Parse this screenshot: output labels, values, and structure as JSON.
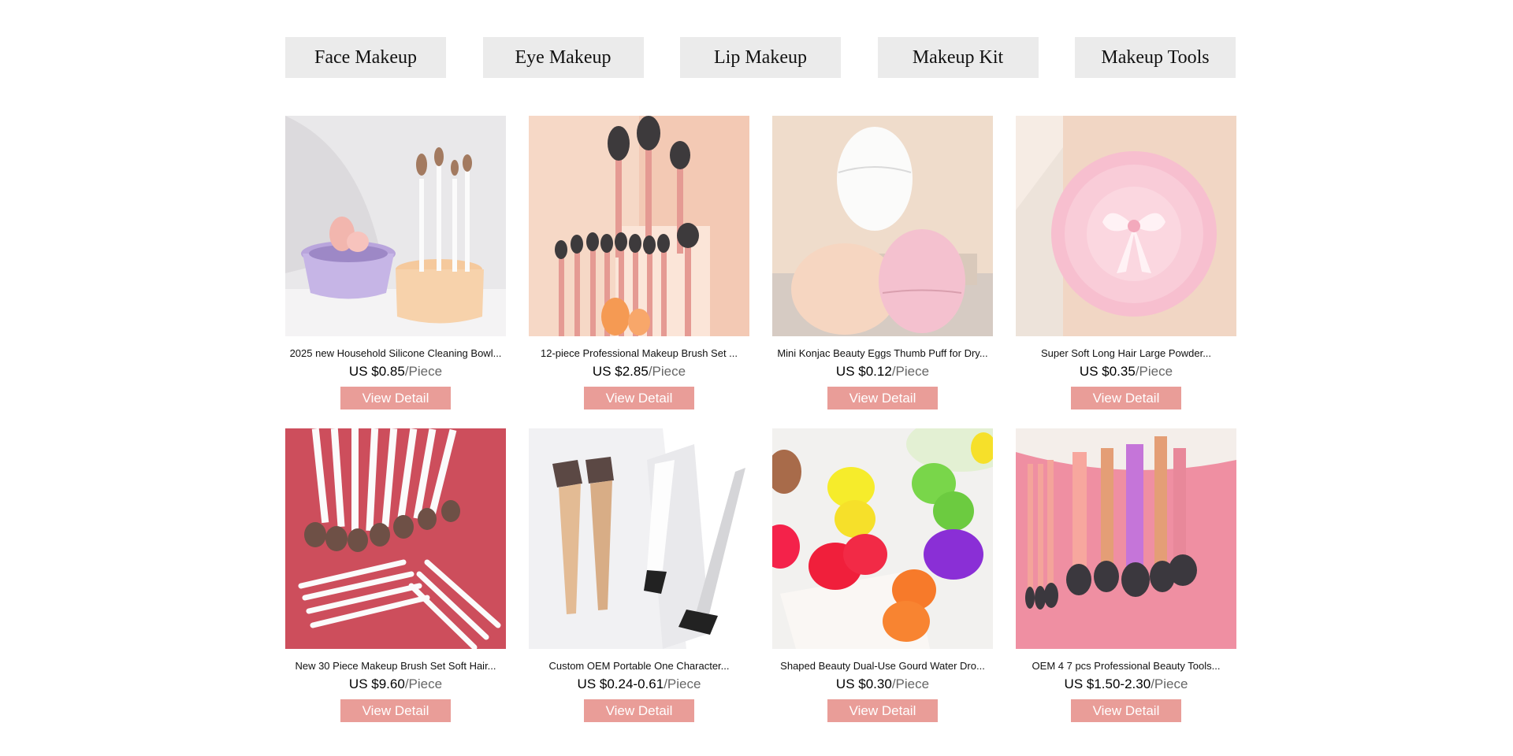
{
  "categories": [
    "Face Makeup",
    "Eye Makeup",
    "Lip Makeup",
    "Makeup Kit",
    "Makeup Tools"
  ],
  "products": [
    {
      "title": "2025 new Household Silicone Cleaning Bowl...",
      "price": "US $0.85",
      "unit": "/Piece",
      "button": "View Detail",
      "image": "silicone-cleaning-bowl-image"
    },
    {
      "title": "12-piece Professional Makeup Brush Set ...",
      "price": "US $2.85",
      "unit": "/Piece",
      "button": "View Detail",
      "image": "brush-set-image"
    },
    {
      "title": "Mini Konjac Beauty Eggs Thumb Puff for Dry...",
      "price": "US $0.12",
      "unit": "/Piece",
      "button": "View Detail",
      "image": "beauty-eggs-image"
    },
    {
      "title": "Super Soft Long Hair Large Powder...",
      "price": "US $0.35",
      "unit": "/Piece",
      "button": "View Detail",
      "image": "powder-puff-image"
    },
    {
      "title": "New 30 Piece Makeup Brush Set Soft Hair...",
      "price": "US $9.60",
      "unit": "/Piece",
      "button": "View Detail",
      "image": "30-piece-brush-set-image"
    },
    {
      "title": "Custom OEM Portable One Character...",
      "price": "US $0.24-0.61",
      "unit": "/Piece",
      "button": "View Detail",
      "image": "flat-brush-image"
    },
    {
      "title": "Shaped Beauty Dual-Use Gourd Water Dro...",
      "price": "US $0.30",
      "unit": "/Piece",
      "button": "View Detail",
      "image": "gourd-sponges-image"
    },
    {
      "title": "OEM 4 7 pcs Professional Beauty Tools...",
      "price": "US $1.50-2.30",
      "unit": "/Piece",
      "button": "View Detail",
      "image": "pink-brushes-image"
    }
  ],
  "colors": {
    "button_bg": "#e99d98",
    "nav_bg": "#ebebeb"
  }
}
